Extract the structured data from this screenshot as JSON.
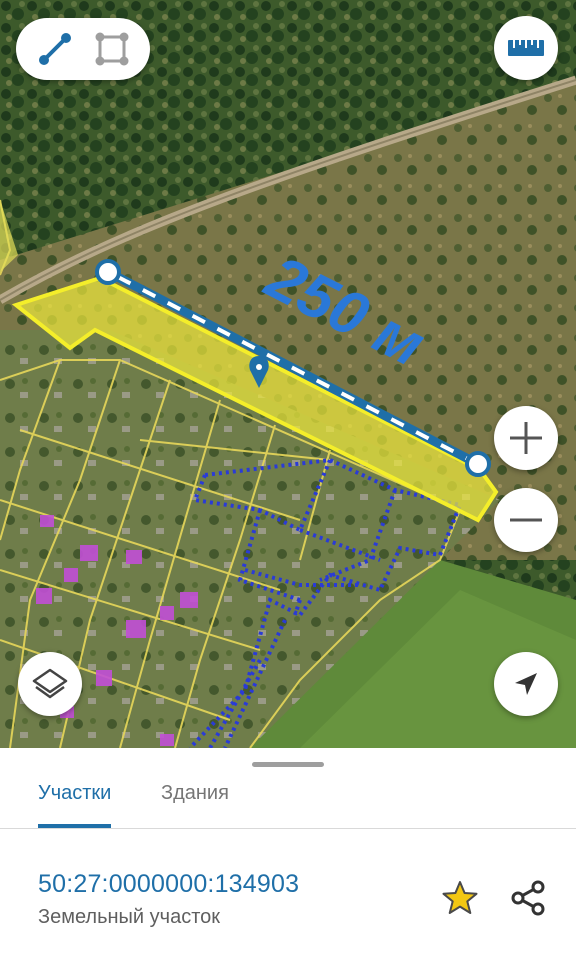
{
  "map": {
    "measure_label": "250 м",
    "icons": {
      "line_tool": "line-measure-icon",
      "polygon_tool": "polygon-measure-icon",
      "ruler": "ruler-icon",
      "zoom_in": "plus-icon",
      "zoom_out": "minus-icon",
      "layers": "layers-icon",
      "locate": "navigation-arrow-icon",
      "marker": "map-pin-icon"
    },
    "colors": {
      "selected_parcel": "#f0ea3c",
      "measure_line": "#1f6fa8",
      "building_outline": "#2a3bd6",
      "building_fill": "#c24fd6"
    }
  },
  "sheet": {
    "tabs": [
      {
        "label": "Участки",
        "active": true
      },
      {
        "label": "Здания",
        "active": false
      }
    ],
    "parcel": {
      "number": "50:27:0000000:134903",
      "type": "Земельный участок"
    },
    "icons": {
      "favorite": "star-icon",
      "share": "share-icon"
    },
    "colors": {
      "accent": "#1f6fa8",
      "star": "#f2c713"
    }
  }
}
